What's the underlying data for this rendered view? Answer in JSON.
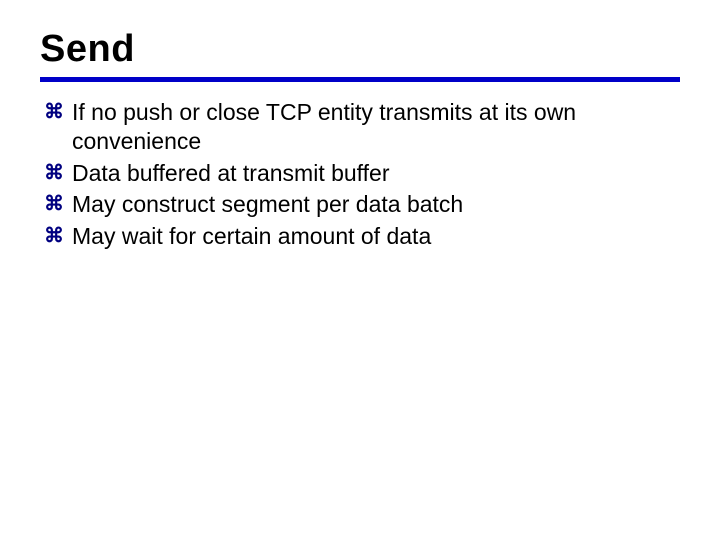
{
  "title": "Send",
  "bullet_glyph": "⌘",
  "bullets": [
    "If no push or close TCP entity transmits at its own convenience",
    "Data buffered at transmit buffer",
    "May construct segment per data batch",
    "May wait for certain amount of data"
  ]
}
